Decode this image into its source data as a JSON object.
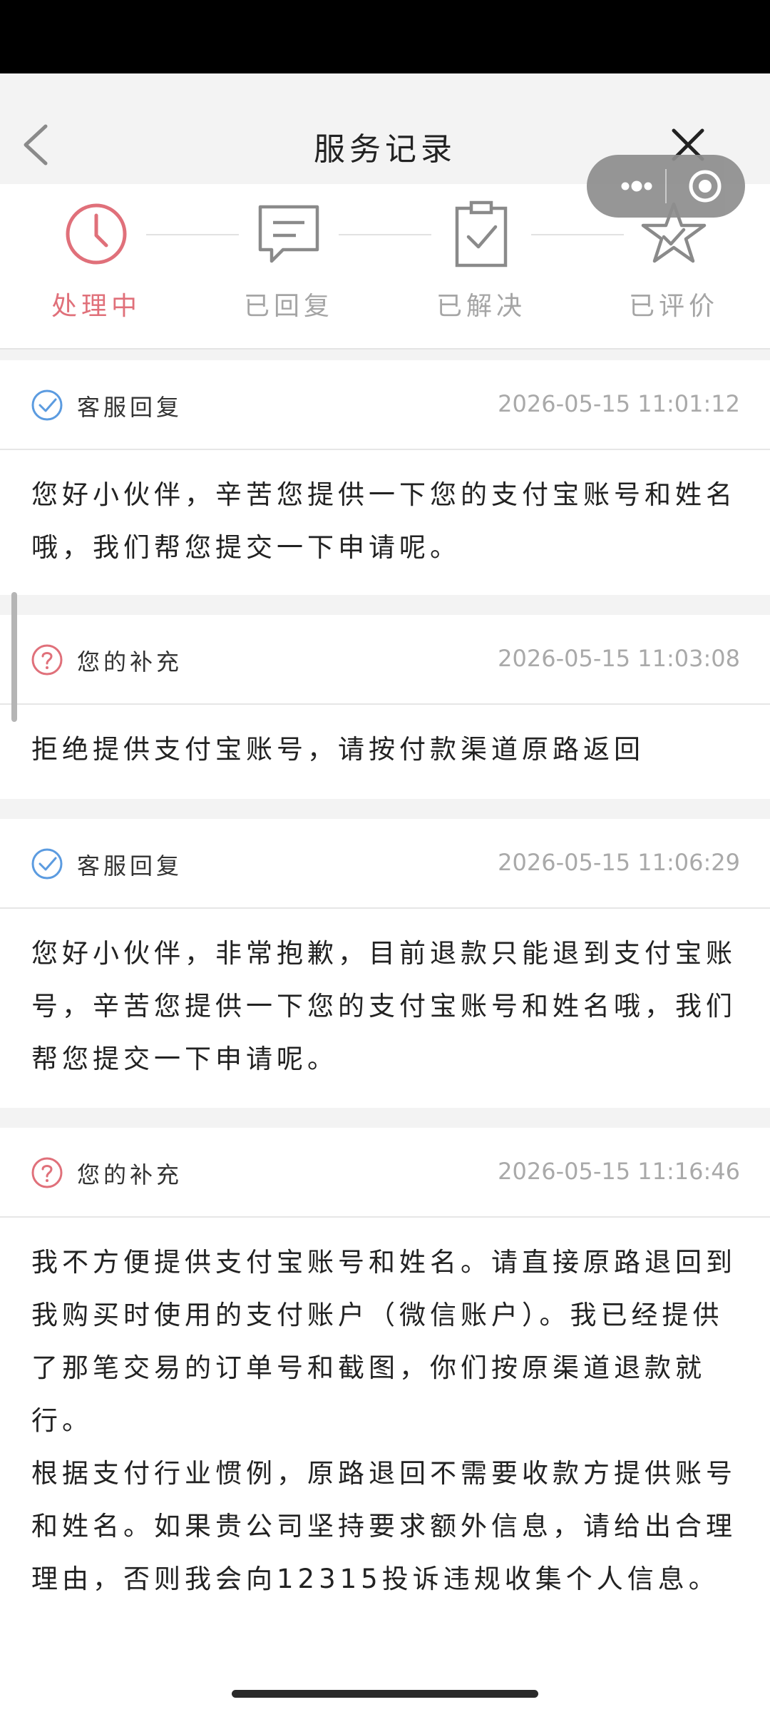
{
  "nav": {
    "title": "服务记录",
    "back_icon": "chevron-left-icon",
    "close_icon": "close-icon"
  },
  "capsule": {
    "more_icon": "more-dots-icon",
    "target_icon": "record-target-icon"
  },
  "steps": [
    {
      "label": "处理中",
      "icon": "clock-icon",
      "active": true
    },
    {
      "label": "已回复",
      "icon": "message-icon",
      "active": false
    },
    {
      "label": "已解决",
      "icon": "clipboard-check-icon",
      "active": false
    },
    {
      "label": "已评价",
      "icon": "star-icon",
      "active": false
    }
  ],
  "colors": {
    "accent": "#e0707a",
    "service_icon": "#5b9be0",
    "muted": "#a5a5a5",
    "separator": "#f3f3f3"
  },
  "messages": [
    {
      "sender": "客服回复",
      "icon": "check-circle-icon",
      "time": "2026-05-15 11:01:12",
      "paragraphs": [
        "您好小伙伴，辛苦您提供一下您的支付宝账号和姓名哦，我们帮您提交一下申请呢。"
      ]
    },
    {
      "sender": "您的补充",
      "icon": "question-circle-icon",
      "time": "2026-05-15 11:03:08",
      "paragraphs": [
        "拒绝提供支付宝账号，请按付款渠道原路返回"
      ]
    },
    {
      "sender": "客服回复",
      "icon": "check-circle-icon",
      "time": "2026-05-15 11:06:29",
      "paragraphs": [
        "您好小伙伴，非常抱歉，目前退款只能退到支付宝账号，辛苦您提供一下您的支付宝账号和姓名哦，我们帮您提交一下申请呢。"
      ]
    },
    {
      "sender": "您的补充",
      "icon": "question-circle-icon",
      "time": "2026-05-15 11:16:46",
      "paragraphs": [
        "我不方便提供支付宝账号和姓名。请直接原路退回到我购买时使用的支付账户（微信账户）。我已经提供了那笔交易的订单号和截图，你们按原渠道退款就行。",
        "根据支付行业惯例，原路退回不需要收款方提供账号和姓名。如果贵公司坚持要求额外信息，请给出合理理由，否则我会向12315投诉违规收集个人信息。"
      ]
    }
  ]
}
